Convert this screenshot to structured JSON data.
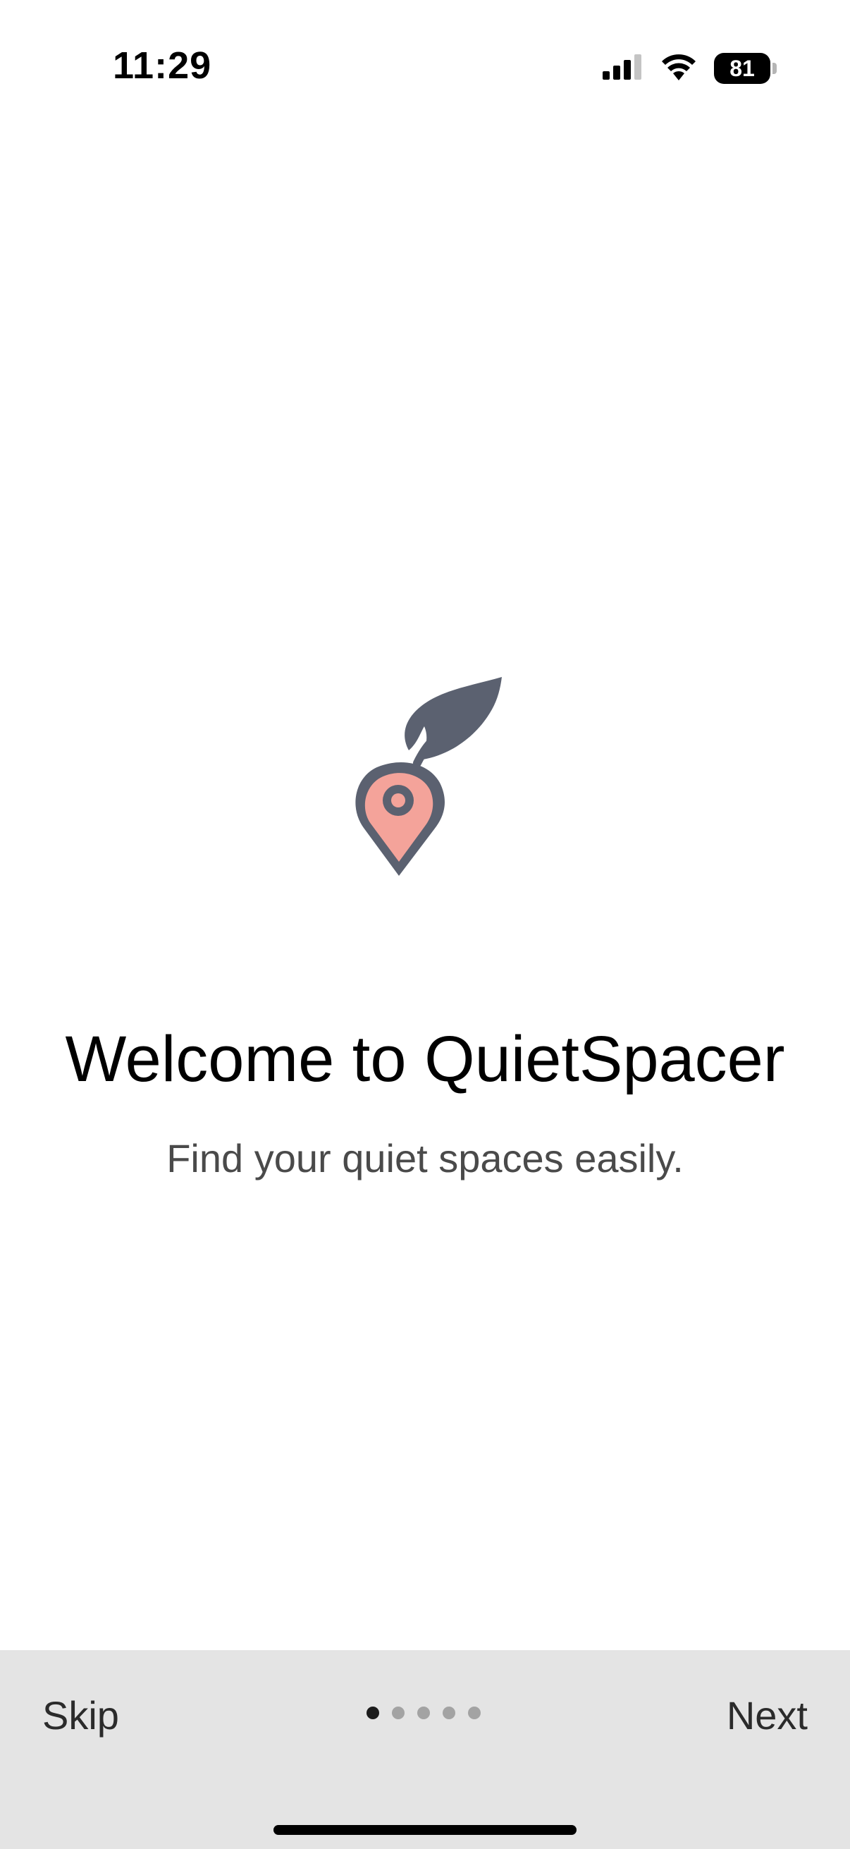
{
  "status_bar": {
    "time": "11:29",
    "battery_level": "81",
    "signal_icon": "cellular-signal-icon",
    "wifi_icon": "wifi-icon"
  },
  "logo": {
    "icon": "location-pin-leaf-icon",
    "colors": {
      "outline": "#5b6170",
      "pin_fill": "#f4a39a"
    }
  },
  "welcome": {
    "title": "Welcome to QuietSpacer",
    "subtitle": "Find your quiet spaces easily."
  },
  "footer": {
    "skip_label": "Skip",
    "next_label": "Next",
    "page_count": 5,
    "current_page": 1
  }
}
